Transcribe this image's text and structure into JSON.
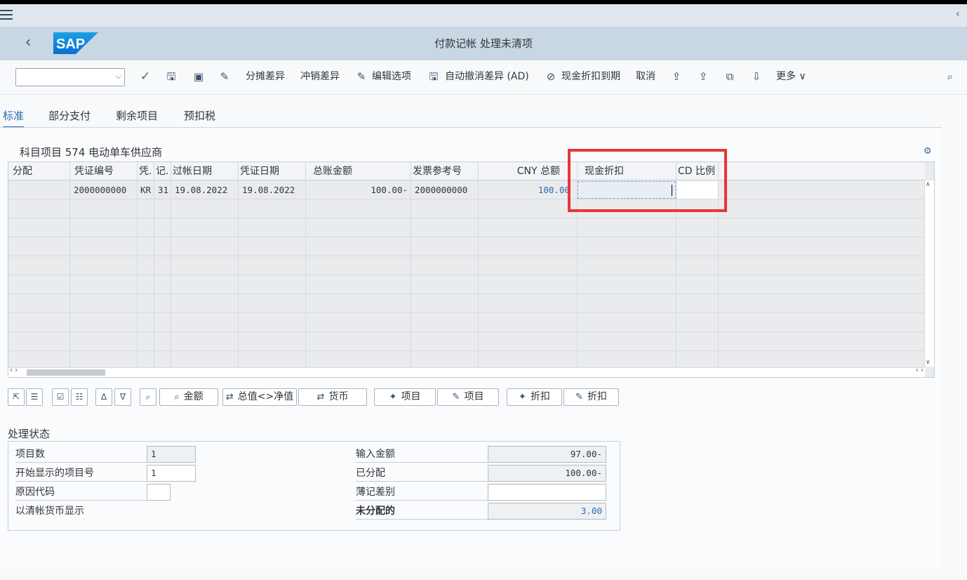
{
  "header": {
    "title": "付款记帐 处理未清项",
    "logo_text": "SAP"
  },
  "toolbar": {
    "command_field_value": "",
    "buttons": {
      "distribute_diff": "分摊差异",
      "write_off_diff": "冲销差异",
      "edit_options": "编辑选项",
      "auto_write_off": "自动撤消差异 (AD)",
      "cash_discount_due": "现金折扣到期",
      "cancel": "取消",
      "more": "更多"
    },
    "icons": [
      "check-icon",
      "save-icon",
      "image-icon",
      "edit-document-icon",
      "pencil-icon",
      "save-icon",
      "circle-slash-icon",
      "export-icon",
      "export-up-icon",
      "copy-icon",
      "download-icon",
      "search-icon"
    ]
  },
  "tabs": [
    {
      "label": "标准",
      "active": true
    },
    {
      "label": "部分支付",
      "active": false
    },
    {
      "label": "剩余项目",
      "active": false
    },
    {
      "label": "预扣税",
      "active": false
    }
  ],
  "section": {
    "title": "科目项目 574 电动单车供应商"
  },
  "grid": {
    "columns": [
      "分配",
      "凭证编号",
      "凭.",
      "记.",
      "过帐日期",
      "凭证日期",
      "总账金额",
      "发票参考号",
      "CNY 总额",
      "现金折扣",
      "CD 比例"
    ],
    "rows": [
      {
        "assignment": "",
        "doc_no": "2000000000",
        "doc_type": "KR",
        "posting_key": "31",
        "posting_date": "19.08.2022",
        "doc_date": "19.08.2022",
        "gl_amount": "100.00-",
        "invoice_ref": "2000000000",
        "cny_total": "100.00",
        "cash_discount": "",
        "cd_pct": ""
      }
    ],
    "empty_rows": 9
  },
  "action_buttons": {
    "amount": "金额",
    "gross_net": "总值<>净值",
    "currency": "货币",
    "item_activate": "项目",
    "item_edit": "项目",
    "discount_activate": "折扣",
    "discount_edit": "折扣"
  },
  "status": {
    "title": "处理状态",
    "items_count_label": "项目数",
    "items_count_value": "1",
    "start_item_label": "开始显示的项目号",
    "start_item_value": "1",
    "reason_code_label": "原因代码",
    "reason_code_value": "",
    "clearing_currency_label": "以清帐货币显示",
    "entered_amount_label": "输入金额",
    "entered_amount_value": "97.00-",
    "assigned_label": "已分配",
    "assigned_value": "100.00-",
    "diff_posted_label": "薄记差别",
    "diff_posted_value": "",
    "unassigned_label": "未分配的",
    "unassigned_value": "3.00"
  },
  "colors": {
    "shell": "#c9d6e3",
    "accent": "#2b6cb0",
    "highlight_box": "#e8343a"
  }
}
